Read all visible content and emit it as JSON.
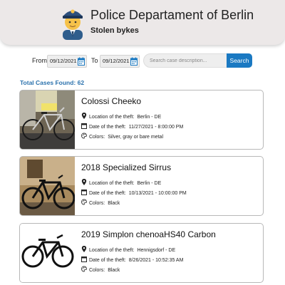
{
  "header": {
    "title": "Police Departament of Berlin",
    "subtitle": "Stolen bykes",
    "logo_icon": "police-officer-emoji"
  },
  "filter": {
    "from_label": "From",
    "from_value": "09/12/2021",
    "to_label": "To",
    "to_value": "09/12/2021",
    "search_placeholder": "Search case description...",
    "search_button": "Search",
    "accent_color": "#1a79c2"
  },
  "total_label": "Total Cases Found: 62",
  "field_labels": {
    "location": "Location of the theft:",
    "date": "Date of the theft:",
    "colors": "Colors:"
  },
  "cases": [
    {
      "title": "Colossi Cheeko",
      "location": "Berlin - DE",
      "date": "11/27/2021 - 8:00:00 PM",
      "colors": "Silver, gray or bare metal"
    },
    {
      "title": "2018 Specialized Sirrus",
      "location": "Berlin - DE",
      "date": "10/13/2021 - 10:00:00 PM",
      "colors": "Black"
    },
    {
      "title": "2019 Simplon chenoaHS40 Carbon",
      "location": "Hennigsdorf - DE",
      "date": "8/26/2021 - 10:52:35 AM",
      "colors": "Black"
    }
  ]
}
